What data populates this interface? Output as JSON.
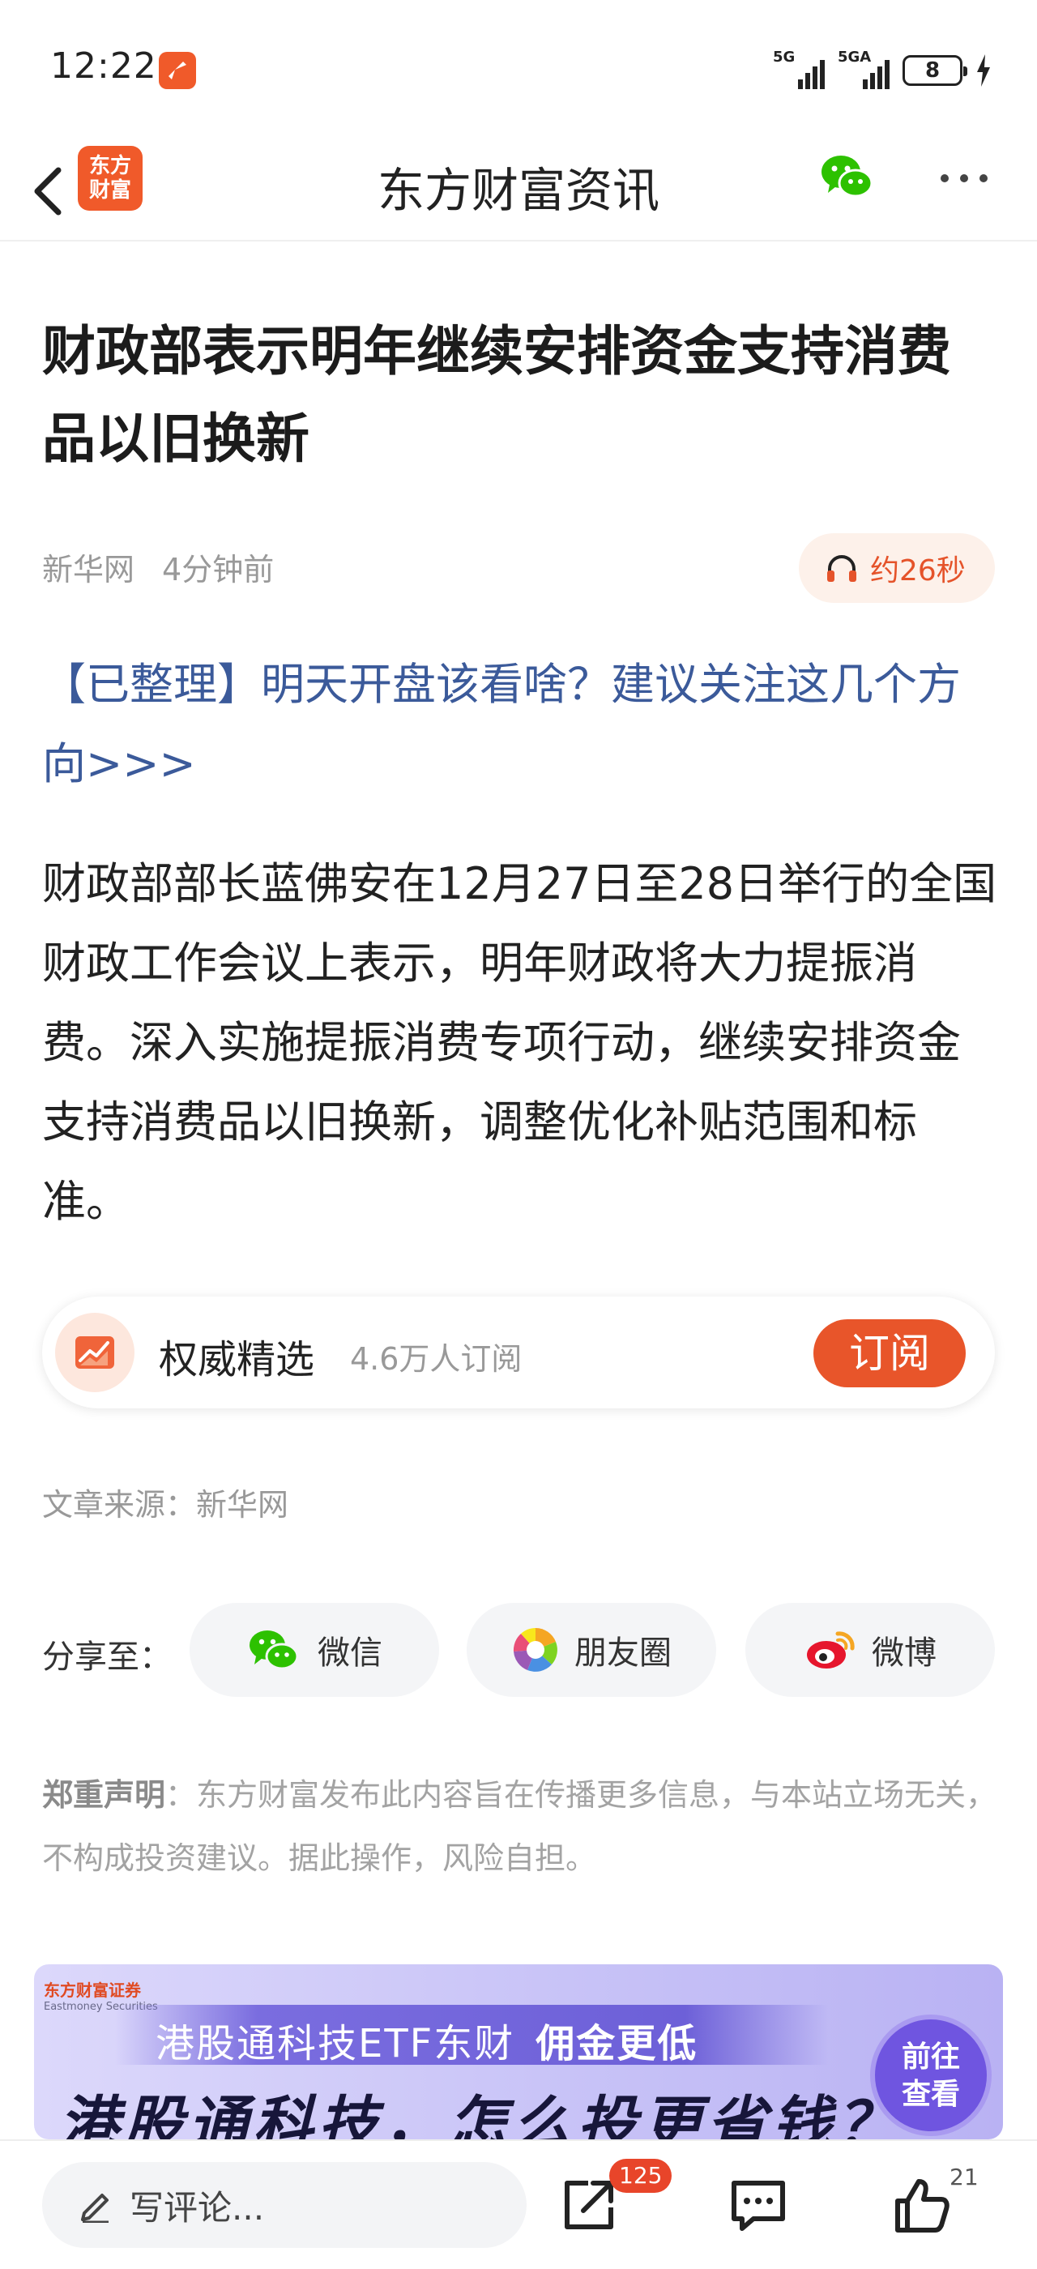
{
  "status_bar": {
    "time": "12:22",
    "signal_1_label": "5G",
    "signal_2_label": "5GA",
    "battery": "8"
  },
  "nav": {
    "logo_text_line1": "东方",
    "logo_text_line2": "财富",
    "title": "东方财富资讯"
  },
  "article": {
    "headline": "财政部表示明年继续安排资金支持消费品以旧换新",
    "source": "新华网",
    "time_ago": "4分钟前",
    "audio_duration": "约26秒",
    "promo_link": "【已整理】明天开盘该看啥？建议关注这几个方向>>>",
    "body": "财政部部长蓝佛安在12月27日至28日举行的全国财政工作会议上表示，明年财政将大力提振消费。深入实施提振消费专项行动，继续安排资金支持消费品以旧换新，调整优化补贴范围和标准。"
  },
  "subscription": {
    "title": "权威精选",
    "subscribers": "4.6万人订阅",
    "button_label": "订阅"
  },
  "source_line": "文章来源：新华网",
  "share": {
    "label": "分享至：",
    "wechat": "微信",
    "moments": "朋友圈",
    "weibo": "微博"
  },
  "disclaimer": {
    "title": "郑重声明",
    "text": "：东方财富发布此内容旨在传播更多信息，与本站立场无关，不构成投资建议。据此操作，风险自担。"
  },
  "banner": {
    "brand": "东方财富证券",
    "brand_en": "Eastmoney Securities",
    "subline": "港股通科技ETF东财",
    "subline_highlight": "佣金更低",
    "headline": "港股通科技，怎么投更省钱？",
    "cta_line1": "前往",
    "cta_line2": "查看"
  },
  "bottom_bar": {
    "comment_placeholder": "写评论...",
    "share_count": "125",
    "like_count": "21"
  },
  "colors": {
    "brand_orange": "#e8552a",
    "link_blue": "#3b5a9a",
    "muted_gray": "#999999"
  },
  "icons": {
    "back": "chevron-left-icon",
    "wechat": "wechat-icon",
    "more": "more-horizontal-icon",
    "headphones": "headphones-icon",
    "chart": "trend-chart-icon",
    "moments": "aperture-icon",
    "weibo": "weibo-icon",
    "pen": "pen-icon",
    "share": "share-out-icon",
    "comment": "comment-icon",
    "like": "thumbs-up-icon"
  }
}
